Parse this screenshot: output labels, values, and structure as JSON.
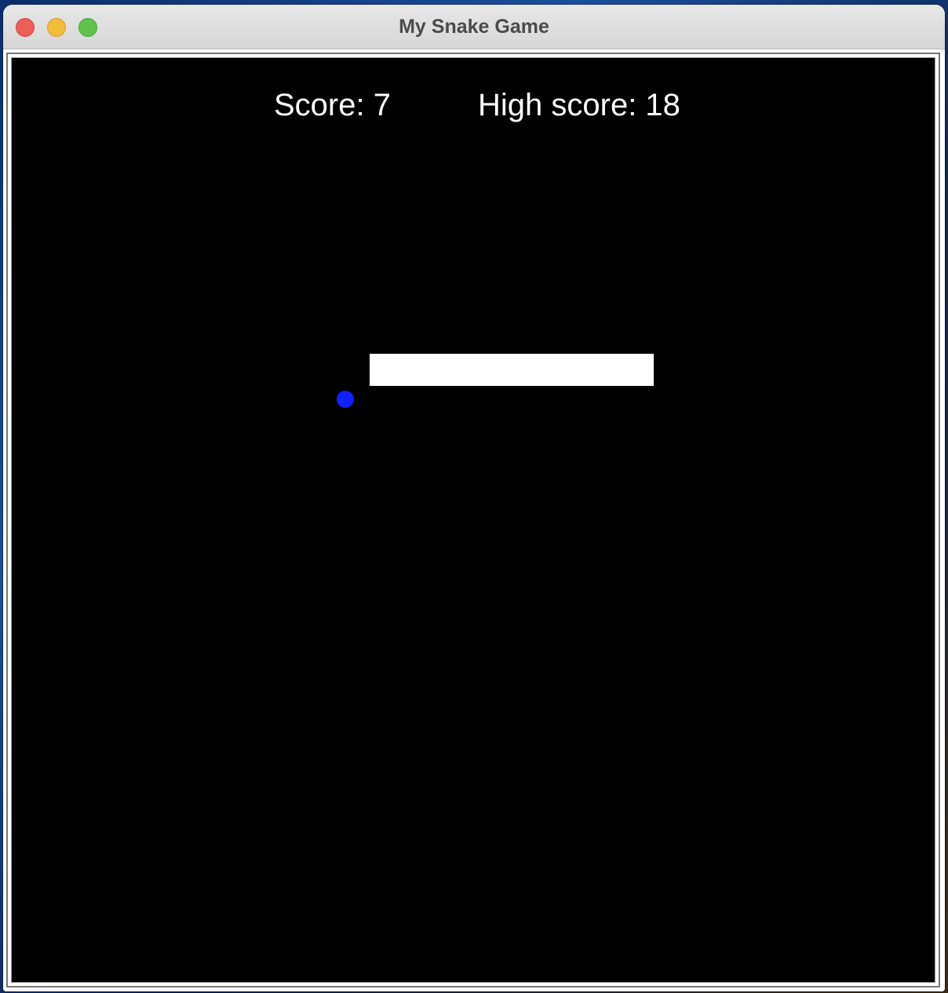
{
  "window": {
    "title": "My Snake Game"
  },
  "hud": {
    "score_text": "Score: 7",
    "high_score_text": "High score: 18",
    "score": 7,
    "high_score": 18
  },
  "colors": {
    "background": "#000000",
    "snake": "#ffffff",
    "food": "#1020ff",
    "text": "#ffffff"
  }
}
